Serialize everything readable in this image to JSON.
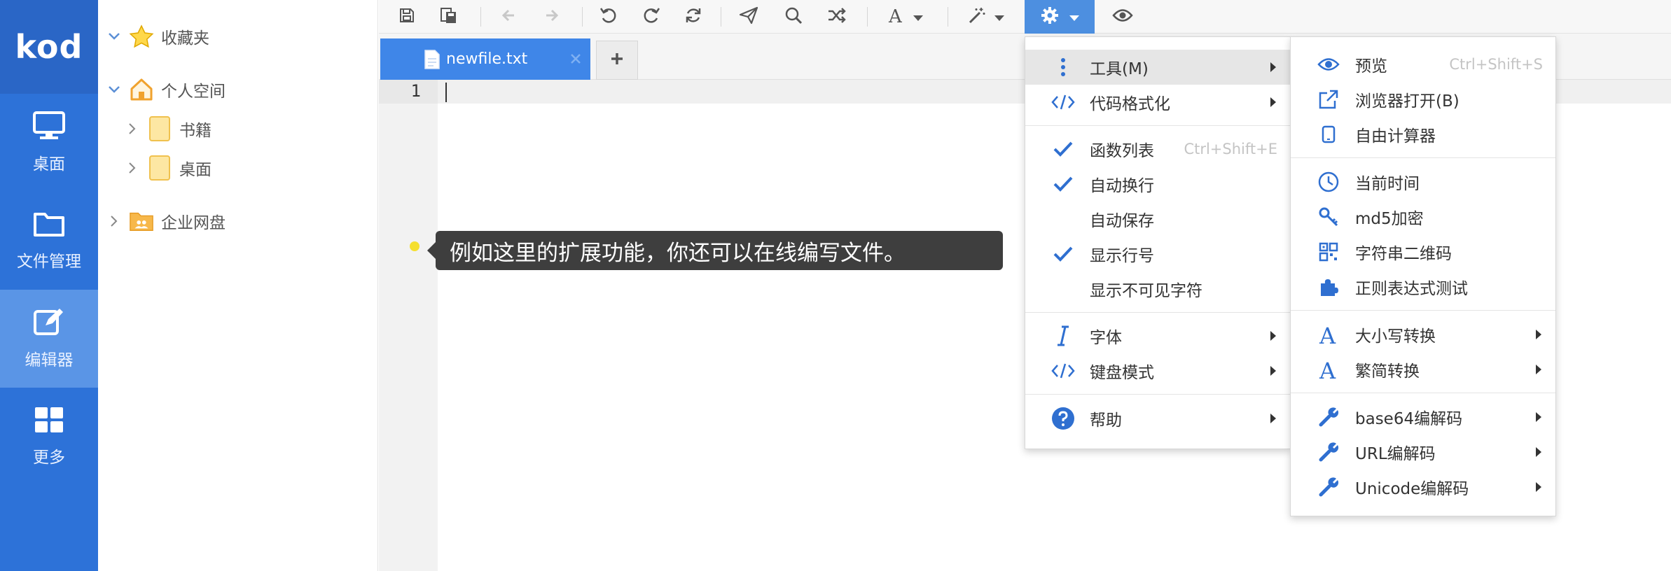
{
  "nav": {
    "logo": "kod",
    "items": [
      {
        "label": "桌面",
        "icon": "desktop-icon"
      },
      {
        "label": "文件管理",
        "icon": "folder-icon"
      },
      {
        "label": "编辑器",
        "icon": "edit-icon"
      },
      {
        "label": "更多",
        "icon": "grid-icon"
      }
    ]
  },
  "tree": {
    "items": [
      {
        "label": "收藏夹",
        "icon": "star-icon"
      },
      {
        "label": "个人空间",
        "icon": "home-icon"
      },
      {
        "label": "书籍",
        "icon": "folder-icon"
      },
      {
        "label": "桌面",
        "icon": "folder-icon"
      },
      {
        "label": "企业网盘",
        "icon": "group-folder-icon"
      }
    ]
  },
  "toolbar": {
    "icons": [
      "save-icon",
      "save-all-icon",
      "arrow-left-icon",
      "arrow-right-icon",
      "undo-icon",
      "redo-icon",
      "refresh-icon",
      "send-icon",
      "search-icon",
      "shuffle-icon",
      "font-icon",
      "magic-wand-icon",
      "gear-icon",
      "eye-icon"
    ]
  },
  "tabs": {
    "file": "newfile.txt",
    "add": "+"
  },
  "editor": {
    "line_number": "1"
  },
  "tooltip": "例如这里的扩展功能，你还可以在线编写文件。",
  "menu1": {
    "items": [
      {
        "label": "工具(M)",
        "icon": "vertical-dots-icon",
        "submenu": true
      },
      {
        "label": "代码格式化",
        "icon": "code-icon",
        "submenu": true
      },
      {
        "label": "函数列表",
        "icon": "check-icon",
        "hotkey": "Ctrl+Shift+E"
      },
      {
        "label": "自动换行",
        "icon": "check-icon"
      },
      {
        "label": "自动保存",
        "icon": ""
      },
      {
        "label": "显示行号",
        "icon": "check-icon"
      },
      {
        "label": "显示不可见字符",
        "icon": ""
      },
      {
        "label": "字体",
        "icon": "italic-icon",
        "submenu": true
      },
      {
        "label": "键盘模式",
        "icon": "code-icon",
        "submenu": true
      },
      {
        "label": "帮助",
        "icon": "help-icon",
        "submenu": true
      }
    ]
  },
  "menu2": {
    "items": [
      {
        "label": "预览",
        "icon": "eye-icon",
        "hotkey": "Ctrl+Shift+S"
      },
      {
        "label": "浏览器打开(B)",
        "icon": "external-link-icon"
      },
      {
        "label": "自由计算器",
        "icon": "tablet-icon"
      },
      {
        "label": "当前时间",
        "icon": "clock-icon"
      },
      {
        "label": "md5加密",
        "icon": "key-icon"
      },
      {
        "label": "字符串二维码",
        "icon": "qrcode-icon"
      },
      {
        "label": "正则表达式测试",
        "icon": "puzzle-icon"
      },
      {
        "label": "大小写转换",
        "icon": "letter-a-icon",
        "submenu": true
      },
      {
        "label": "繁简转换",
        "icon": "letter-a-icon",
        "submenu": true
      },
      {
        "label": "base64编解码",
        "icon": "wrench-icon",
        "submenu": true
      },
      {
        "label": "URL编解码",
        "icon": "wrench-icon",
        "submenu": true
      },
      {
        "label": "Unicode编解码",
        "icon": "wrench-icon",
        "submenu": true
      }
    ]
  },
  "colors": {
    "nav_bg": "#2d72d8",
    "nav_active": "#5a95e6",
    "accent": "#3f86e8",
    "menu_icon": "#2f6fd0"
  }
}
